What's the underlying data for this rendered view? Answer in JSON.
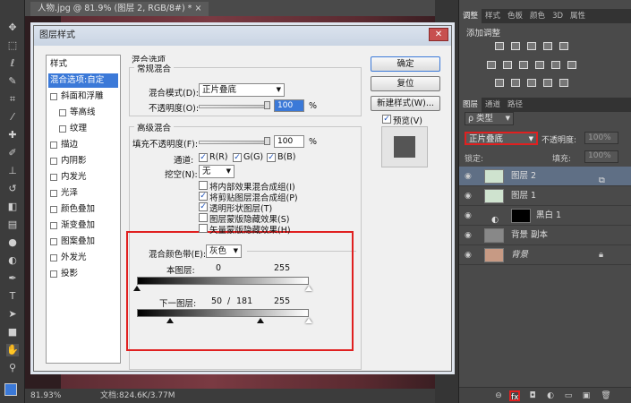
{
  "document": {
    "tab_title": "人物.jpg @ 81.9% (图层 2, RGB/8#) *",
    "zoom": "81.93%",
    "doc_info": "文档:824.6K/3.77M"
  },
  "right_panel": {
    "top_tabs": [
      "调整",
      "样式",
      "色板",
      "颜色",
      "3D",
      "属性"
    ],
    "adjust_title": "添加调整",
    "layer_tabs": [
      "图层",
      "通道",
      "路径"
    ],
    "kind_label": "ρ 类型",
    "blend_mode": "正片叠底",
    "opacity_label": "不透明度:",
    "opacity_value": "100%",
    "lock_label": "锁定:",
    "fill_label": "填充:",
    "fill_value": "100%",
    "layers": [
      {
        "name": "图层 2"
      },
      {
        "name": "图层 1"
      },
      {
        "name": "黑白 1"
      },
      {
        "name": "背景 副本"
      },
      {
        "name": "背景"
      }
    ],
    "footer_fx": "fx"
  },
  "dialog": {
    "title": "图层样式",
    "close": "✕",
    "styles_header": "样式",
    "styles": [
      {
        "label": "混合选项:自定",
        "selected": true,
        "checkbox": false,
        "indent": false
      },
      {
        "label": "斜面和浮雕",
        "checkbox": true,
        "indent": false
      },
      {
        "label": "等高线",
        "checkbox": true,
        "indent": true
      },
      {
        "label": "纹理",
        "checkbox": true,
        "indent": true
      },
      {
        "label": "描边",
        "checkbox": true,
        "indent": false
      },
      {
        "label": "内阴影",
        "checkbox": true,
        "indent": false
      },
      {
        "label": "内发光",
        "checkbox": true,
        "indent": false
      },
      {
        "label": "光泽",
        "checkbox": true,
        "indent": false
      },
      {
        "label": "颜色叠加",
        "checkbox": true,
        "indent": false
      },
      {
        "label": "渐变叠加",
        "checkbox": true,
        "indent": false
      },
      {
        "label": "图案叠加",
        "checkbox": true,
        "indent": false
      },
      {
        "label": "外发光",
        "checkbox": true,
        "indent": false
      },
      {
        "label": "投影",
        "checkbox": true,
        "indent": false
      }
    ],
    "blend_options_title": "混合选项",
    "general_blend_title": "常规混合",
    "blend_mode_label": "混合模式(D):",
    "blend_mode_value": "正片叠底",
    "opacity_label": "不透明度(O):",
    "opacity_value": "100",
    "percent": "%",
    "advanced_blend_title": "高级混合",
    "fill_opacity_label": "填充不透明度(F):",
    "fill_opacity_value": "100",
    "channels_label": "通道:",
    "channel_r": "R(R)",
    "channel_g": "G(G)",
    "channel_b": "B(B)",
    "knockout_label": "挖空(N):",
    "knockout_value": "无",
    "options": [
      {
        "label": "将内部效果混合成组(I)",
        "checked": false
      },
      {
        "label": "将剪贴图层混合成组(P)",
        "checked": true
      },
      {
        "label": "透明形状图层(T)",
        "checked": true
      },
      {
        "label": "图层蒙版隐藏效果(S)",
        "checked": false
      },
      {
        "label": "矢量蒙版隐藏效果(H)",
        "checked": false
      }
    ],
    "blend_if_label": "混合颜色带(E):",
    "blend_if_value": "灰色",
    "this_layer_label": "本图层:",
    "this_layer_low": "0",
    "this_layer_high": "255",
    "underlying_label": "下一图层:",
    "underlying_low": "50",
    "underlying_sep": "/",
    "underlying_split": "181",
    "underlying_high": "255",
    "ok_button": "确定",
    "reset_button": "复位",
    "new_style_button": "新建样式(W)...",
    "preview_label": "预览(V)"
  },
  "colors": {
    "highlight": "#e02020",
    "selected": "#3b79d8"
  }
}
